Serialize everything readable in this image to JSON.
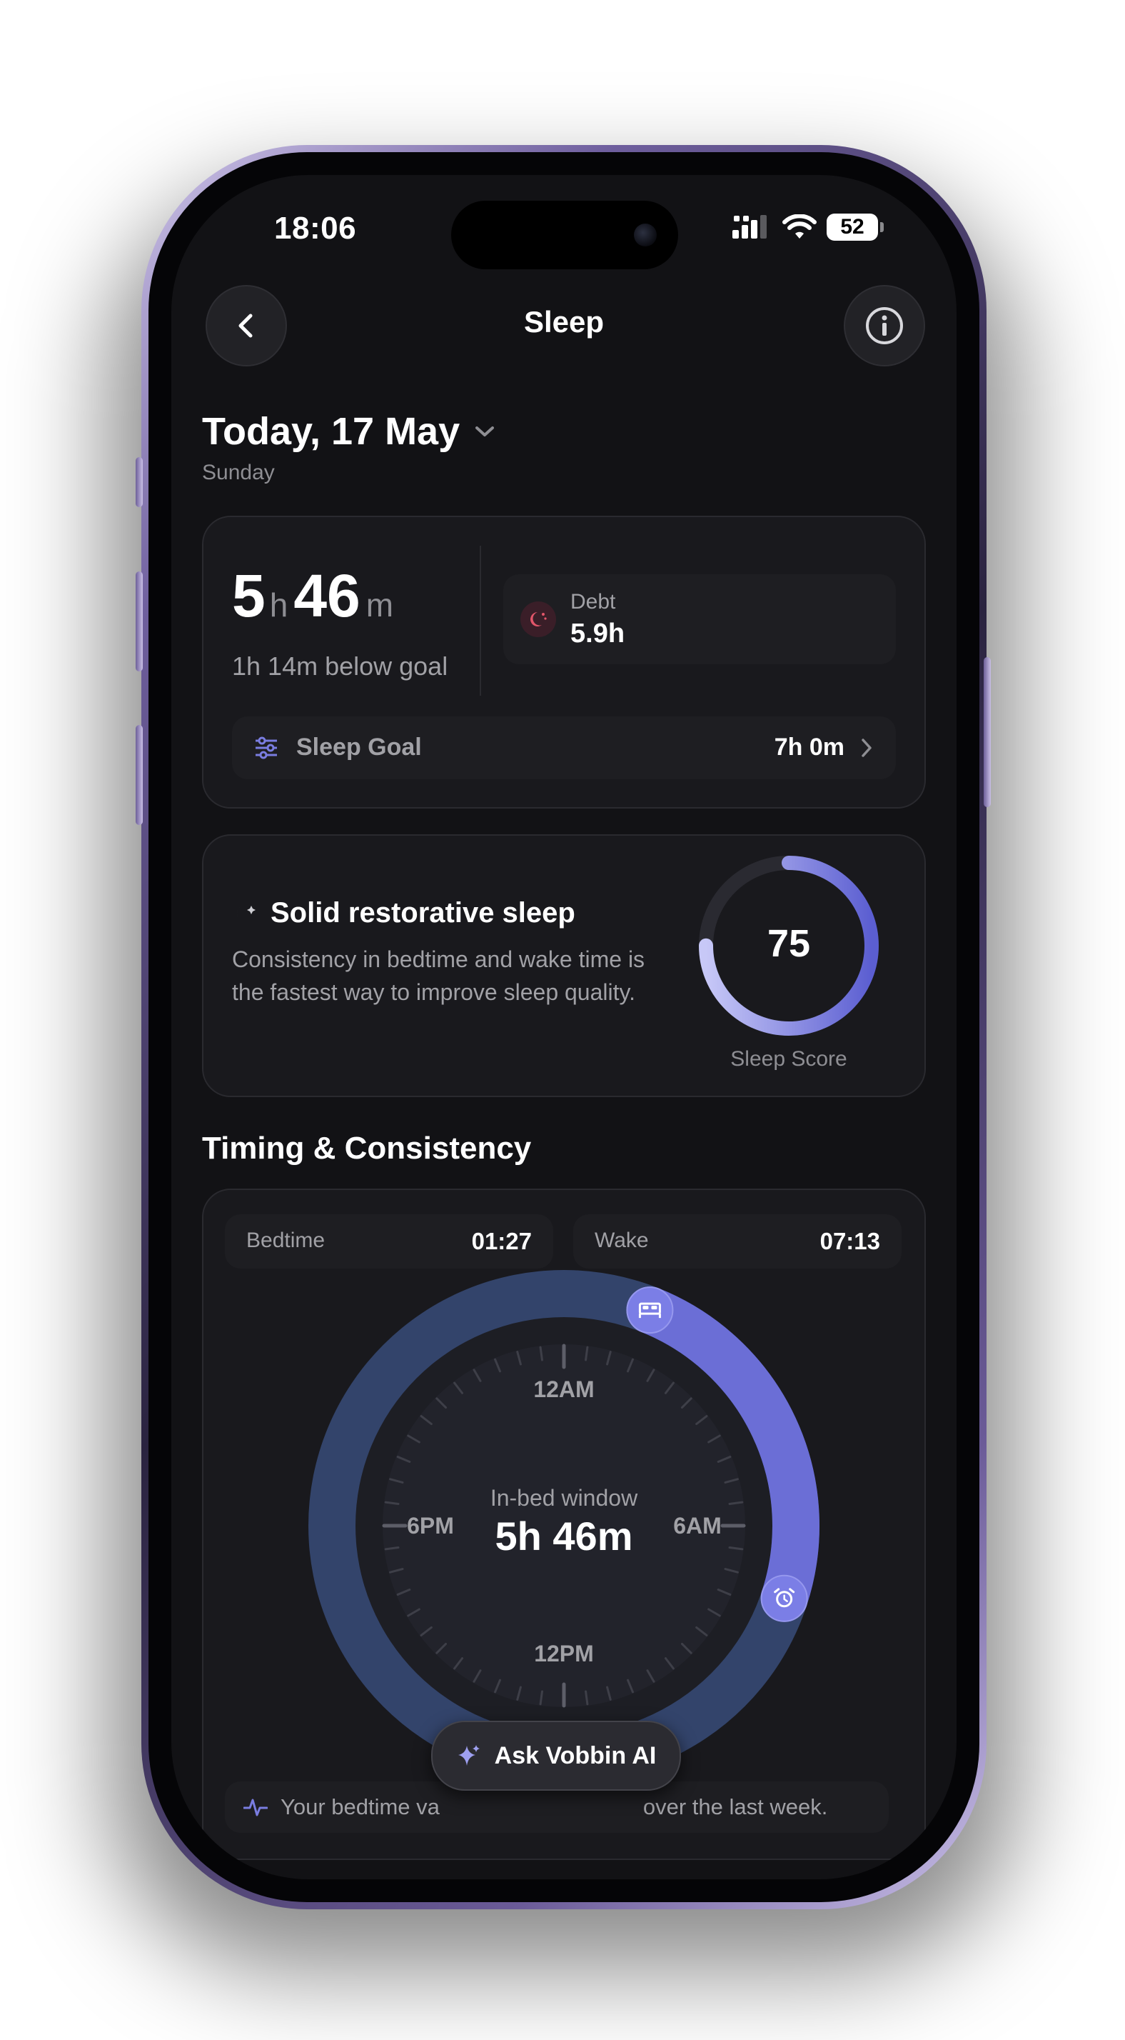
{
  "status_bar": {
    "time": "18:06",
    "battery": "52"
  },
  "nav": {
    "title": "Sleep"
  },
  "date": {
    "title": "Today, 17 May",
    "weekday": "Sunday"
  },
  "summary": {
    "hours": "5",
    "hours_unit": "h",
    "minutes": "46",
    "minutes_unit": "m",
    "below_goal": "1h 14m below goal",
    "debt_label": "Debt",
    "debt_value": "5.9h",
    "goal_label": "Sleep Goal",
    "goal_value": "7h 0m"
  },
  "score_card": {
    "title": "Solid restorative sleep",
    "description": "Consistency in bedtime and wake time is the fastest way to improve sleep quality.",
    "score": "75",
    "score_label": "Sleep Score",
    "score_fraction": 0.75
  },
  "timing": {
    "section_title": "Timing & Consistency",
    "bedtime_label": "Bedtime",
    "bedtime_value": "01:27",
    "wake_label": "Wake",
    "wake_value": "07:13",
    "dial_labels": {
      "top": "12AM",
      "right": "6AM",
      "bottom": "12PM",
      "left": "6PM"
    },
    "window_label": "In-bed window",
    "window_value": "5h 46m",
    "insight": "Your bedtime varied by over the last week.",
    "insight_before": "Your bedtime va",
    "insight_after": "over the last week."
  },
  "ai_button": {
    "label": "Ask Vobbin AI"
  },
  "colors": {
    "accent": "#6b6ed6",
    "debt": "#e2566a",
    "ring_track": "#34456b",
    "background": "#121215"
  },
  "icons": [
    "back-icon",
    "info-icon",
    "chevron-down-icon",
    "moon-debt-icon",
    "sliders-icon",
    "chevron-right-icon",
    "moon-icon",
    "bed-icon",
    "alarm-icon",
    "sparkle-icon",
    "pulse-icon",
    "signal-icon",
    "wifi-icon",
    "battery-icon"
  ]
}
